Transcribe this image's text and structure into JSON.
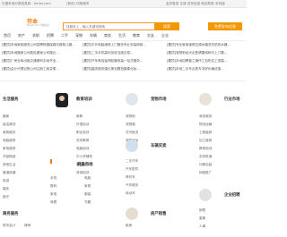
{
  "topbar": {
    "left": "中国本地分类信息网 - fenlei.com",
    "mid": "[首页] 切换城市",
    "right": "会员登录  注册  发布信息  网站导航  手机版"
  },
  "logo": {
    "name": "芬本",
    "sub": "fenlei.com 分类信息"
  },
  "search": {
    "placeholder": "找服务上，输入关键词搜索",
    "button": "搜索"
  },
  "post_button": "免费发布信息",
  "nav": [
    "首页",
    "房产",
    "求职",
    "招聘",
    "二手",
    "宠物",
    "车辆",
    "商务",
    "生活",
    "教育",
    "交友",
    "企业"
  ],
  "notices": [
    "[置顶]本地家政服务公司招聘阿姨保姆月嫂育儿嫂...",
    "[置顶]平价电脑维修上门服务专业安装网络...",
    "[置顶]专业家电维修空调冰箱洗衣机热水器...",
    "[置顶]本地搬家公司居民搬家公司搬迁...",
    "[置顶]二手手机高价回收当面交易...",
    "[置顶]宠物狗幼犬出售健康纯种可上门看...",
    "[置顶]厂房仓库出租交通便利手续齐全...",
    "[置顶]汽车美容装饰贴膜改装一站式服务...",
    "[置顶]本地招聘普工操作工包吃住工资高...",
    "[置顶]会计代理记账公司注册工商变更...",
    "[置顶]婚庆服务婚礼策划跟拍摄像化妆...",
    "[置顶]本地二手车出售车况好价格优惠..."
  ],
  "categories": [
    {
      "title": "生活服务",
      "icon": "service-icon",
      "items": [
        "搬家",
        "保洁清洗",
        "家政服务",
        "电脑维修",
        "家电维修",
        "开锁换锁",
        "其他生活",
        "管道疏通",
        "旅游",
        "婚庆",
        "医疗"
      ]
    },
    {
      "title": "教育培训",
      "icon": "education-icon",
      "items": [
        "家教",
        "外语培训",
        "职业培训",
        "学历教育",
        "电脑培训",
        "中小学辅导",
        "驾校培训",
        "其他培训"
      ]
    },
    {
      "title": "宠物市场",
      "icon": "pet-icon",
      "items": [
        "宠物狗",
        "宠物猫",
        "花鸟鱼虫",
        "宠物用品",
        "宠物服务",
        "宠物领养"
      ]
    },
    {
      "title": "行业市场",
      "icon": "industry-icon",
      "items": [
        "商务服务",
        "物流运输",
        "工程装修",
        "加工维修",
        "教育培训",
        "农林牧渔",
        "印刷包装",
        "网络推广",
        "IT服务"
      ]
    },
    {
      "title": "车辆买卖",
      "icon": "car-icon",
      "items": [
        "二手汽车",
        "汽车配件",
        "摩托车",
        "汽车服务",
        "电动车",
        "自行车",
        "货车",
        "拖拉机"
      ]
    },
    {
      "title": "跳蚤市场",
      "icon": "flea-icon",
      "items": [
        "手机",
        "电脑",
        "数码",
        "家具",
        "家电",
        "服装",
        "母婴",
        "书籍"
      ]
    },
    {
      "title": "商务服务",
      "icon": "business-icon",
      "items": [
        "财务会计",
        "律师",
        "保险",
        "快递"
      ]
    },
    {
      "title": "房产租售",
      "icon": "house-icon",
      "items": [
        "租房",
        "二手房",
        "商铺",
        "厂房"
      ]
    },
    {
      "title": "企业招聘",
      "icon": "job-icon",
      "items": [
        "销售",
        "客服",
        "人事"
      ]
    }
  ],
  "colors": {
    "accent": "#f39800",
    "text": "#555555"
  }
}
